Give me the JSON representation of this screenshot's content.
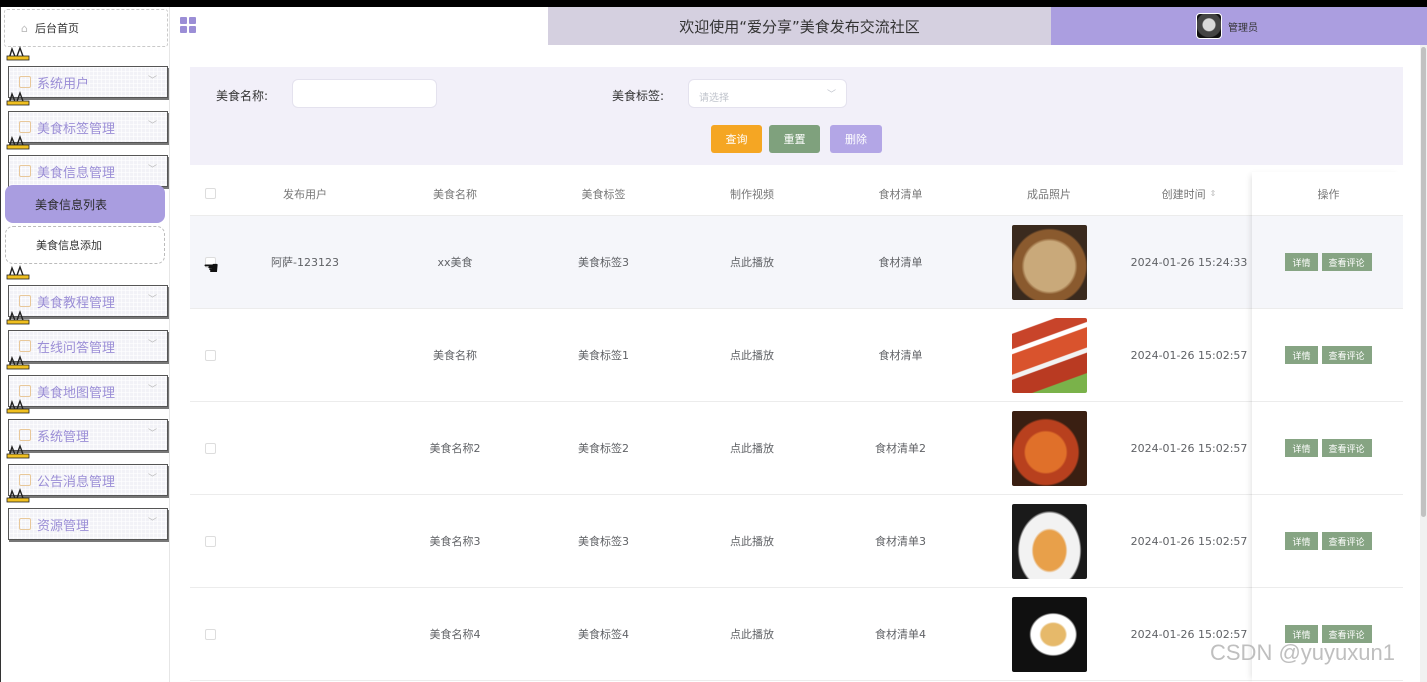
{
  "sidebar": {
    "home": "后台首页",
    "menus": [
      "系统用户",
      "美食标签管理",
      "美食信息管理",
      "美食教程管理",
      "在线问答管理",
      "美食地图管理",
      "系统管理",
      "公告消息管理",
      "资源管理"
    ],
    "sub_active": "美食信息列表",
    "sub_add": "美食信息添加"
  },
  "header": {
    "title": "欢迎使用“爱分享”美食发布交流社区",
    "user": "管理员"
  },
  "filter": {
    "name_label": "美食名称:",
    "tag_label": "美食标签:",
    "tag_placeholder": "请选择",
    "search": "查询",
    "reset": "重置",
    "delete": "删除"
  },
  "table": {
    "headers": [
      "发布用户",
      "美食名称",
      "美食标签",
      "制作视频",
      "食材清单",
      "成品照片",
      "创建时间",
      "操作"
    ],
    "rows": [
      {
        "user": "阿萨-123123",
        "name": "xx美食",
        "tag": "美食标签3",
        "video": "点此播放",
        "list": "食材清单",
        "time": "2024-01-26 15:24:33"
      },
      {
        "user": "",
        "name": "美食名称",
        "tag": "美食标签1",
        "video": "点此播放",
        "list": "食材清单",
        "time": "2024-01-26 15:02:57"
      },
      {
        "user": "",
        "name": "美食名称2",
        "tag": "美食标签2",
        "video": "点此播放",
        "list": "食材清单2",
        "time": "2024-01-26 15:02:57"
      },
      {
        "user": "",
        "name": "美食名称3",
        "tag": "美食标签3",
        "video": "点此播放",
        "list": "食材清单3",
        "time": "2024-01-26 15:02:57"
      },
      {
        "user": "",
        "name": "美食名称4",
        "tag": "美食标签4",
        "video": "点此播放",
        "list": "食材清单4",
        "time": "2024-01-26 15:02:57"
      }
    ],
    "detail_btn": "详情",
    "comment_btn": "查看评论"
  },
  "watermark": "CSDN @yuyuxun1",
  "colors": {
    "accent": "#ab9ee0",
    "search": "#f5a623",
    "reset": "#7fa17d",
    "delete": "#b3a6e6",
    "op": "#86a483"
  }
}
